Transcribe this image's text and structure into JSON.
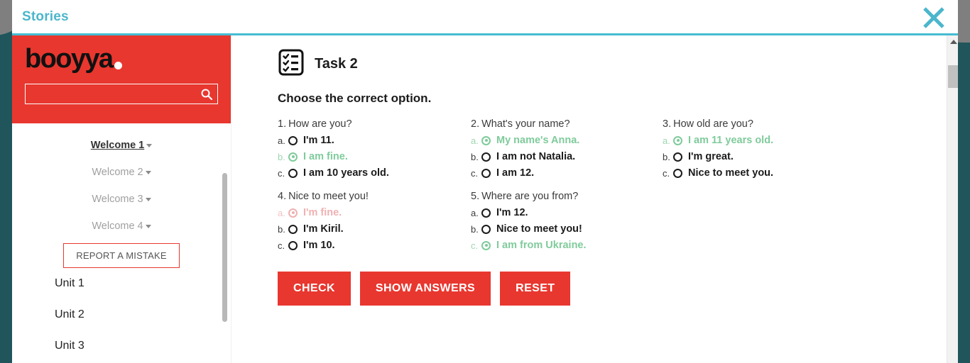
{
  "window": {
    "title": "Stories",
    "close_icon": "close-icon"
  },
  "sidebar": {
    "logo_text": "booyya",
    "search": {
      "value": "",
      "placeholder": "",
      "icon": "search-icon"
    },
    "welcome_items": [
      {
        "label": "Welcome 1",
        "active": true
      },
      {
        "label": "Welcome 2",
        "active": false
      },
      {
        "label": "Welcome 3",
        "active": false
      },
      {
        "label": "Welcome 4",
        "active": false
      }
    ],
    "report_button": "REPORT A MISTAKE",
    "units": [
      {
        "label": "Unit 1"
      },
      {
        "label": "Unit 2"
      },
      {
        "label": "Unit 3"
      }
    ]
  },
  "main": {
    "task_icon": "checklist-clipboard-icon",
    "task_title": "Task 2",
    "instruction": "Choose the correct option.",
    "questions": [
      {
        "number": "1.",
        "text": "How are you?",
        "options": [
          {
            "letter": "a.",
            "text": "I'm 11.",
            "state": "neutral"
          },
          {
            "letter": "b.",
            "text": "I am fine.",
            "state": "correct"
          },
          {
            "letter": "c.",
            "text": "I am 10 years old.",
            "state": "neutral"
          }
        ]
      },
      {
        "number": "2.",
        "text": "What's your name?",
        "options": [
          {
            "letter": "a.",
            "text": "My name's Anna.",
            "state": "correct"
          },
          {
            "letter": "b.",
            "text": "I am not Natalia.",
            "state": "neutral"
          },
          {
            "letter": "c.",
            "text": "I am 12.",
            "state": "neutral"
          }
        ]
      },
      {
        "number": "3.",
        "text": "How old are you?",
        "options": [
          {
            "letter": "a.",
            "text": "I am 11 years old.",
            "state": "correct"
          },
          {
            "letter": "b.",
            "text": "I'm great.",
            "state": "neutral"
          },
          {
            "letter": "c.",
            "text": "Nice to meet you.",
            "state": "neutral"
          }
        ]
      },
      {
        "number": "4.",
        "text": "Nice to meet you!",
        "options": [
          {
            "letter": "a.",
            "text": "I'm fine.",
            "state": "wrong"
          },
          {
            "letter": "b.",
            "text": "I'm Kiril.",
            "state": "neutral"
          },
          {
            "letter": "c.",
            "text": "I'm 10.",
            "state": "neutral"
          }
        ]
      },
      {
        "number": "5.",
        "text": "Where are you from?",
        "options": [
          {
            "letter": "a.",
            "text": "I'm 12.",
            "state": "neutral"
          },
          {
            "letter": "b.",
            "text": "Nice to meet you!",
            "state": "neutral"
          },
          {
            "letter": "c.",
            "text": "I am from Ukraine.",
            "state": "correct"
          }
        ]
      }
    ],
    "buttons": [
      {
        "label": "CHECK",
        "name": "check-button"
      },
      {
        "label": "SHOW ANSWERS",
        "name": "show-answers-button"
      },
      {
        "label": "RESET",
        "name": "reset-button"
      }
    ]
  },
  "colors": {
    "brand_red": "#e8372f",
    "accent_teal": "#4bb6cc",
    "page_backdrop": "#20555c",
    "correct_green": "#7fcb9b",
    "wrong_pink": "#f0b1b1"
  }
}
